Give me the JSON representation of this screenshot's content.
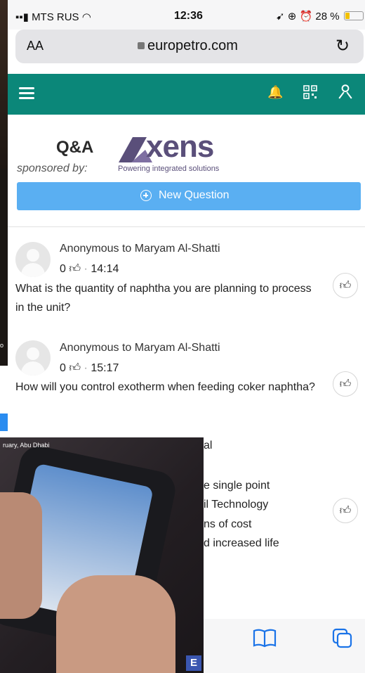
{
  "status_bar": {
    "carrier": "MTS RUS",
    "time": "12:36",
    "battery": "28 %"
  },
  "browser": {
    "aa_label": "AA",
    "url": "europetro.com"
  },
  "sponsor": {
    "title": "Q&A",
    "sponsored_by": "sponsored by:",
    "logo_text": "xens",
    "logo_tagline": "Powering integrated solutions"
  },
  "new_question_label": "New Question",
  "questions": [
    {
      "author": "Anonymous to Maryam Al-Shatti",
      "likes": "0",
      "time": "14:14",
      "text": "What is the quantity of naphtha you are planning to process in the unit?"
    },
    {
      "author": "Anonymous to Maryam Al-Shatti",
      "likes": "0",
      "time": "15:17",
      "text": "How will you control exotherm when feeding coker naphtha?"
    }
  ],
  "partial_question": {
    "lines": [
      "al",
      "e single point",
      "il Technology",
      "ns of cost",
      "d increased life"
    ]
  },
  "video_overlay": {
    "caption": "ruary, Abu Dhabi",
    "logo_letter": "E",
    "left_strip_label": "o"
  },
  "colors": {
    "nav_teal": "#0b8779",
    "button_blue": "#5aaff2",
    "logo_purple": "#5a4f7a",
    "icon_blue": "#1a73e8"
  }
}
